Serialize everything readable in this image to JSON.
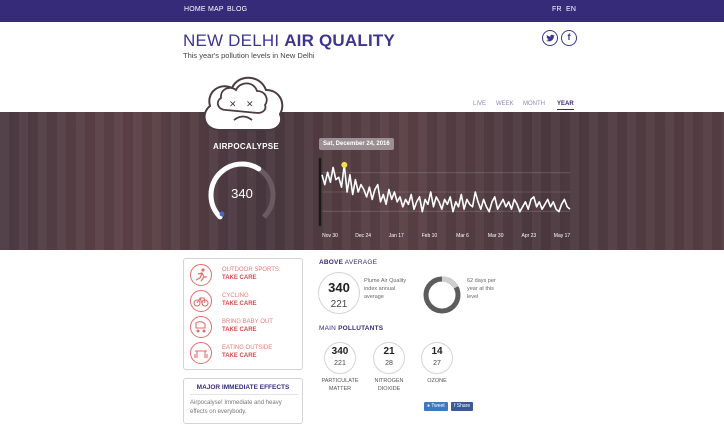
{
  "nav": {
    "home": "HOME",
    "map": "MAP",
    "blog": "BLOG",
    "lang_fr": "FR",
    "lang_en": "EN"
  },
  "header": {
    "title_light": "NEW DELHI",
    "title_bold": "AIR QUALITY",
    "subtitle": "This year's pollution levels in New Delhi",
    "twitter_icon": "twitter-icon",
    "facebook_icon": "facebook-icon"
  },
  "tabs": [
    "LIVE",
    "WEEK",
    "MONTH",
    "YEAR"
  ],
  "active_tab": "YEAR",
  "hero": {
    "status_label": "AIRPOCALYPSE",
    "aqi_value": "340",
    "aqi_fraction": 0.62,
    "selected_date": "Sat, December 24, 2016",
    "cloud_icon": "sad-cloud-icon",
    "accent": "#352b78"
  },
  "chart_data": {
    "type": "line",
    "x_labels": [
      "Nov 30",
      "Dec 24",
      "Jan 17",
      "Feb 10",
      "Mar 6",
      "Mar 30",
      "Apr 23",
      "May 17"
    ],
    "values": [
      300,
      260,
      310,
      270,
      330,
      280,
      290,
      250,
      340,
      230,
      300,
      220,
      280,
      230,
      260,
      240,
      210,
      250,
      200,
      240,
      260,
      190,
      220,
      180,
      240,
      200,
      230,
      190,
      210,
      170,
      200,
      180,
      220,
      160,
      190,
      210,
      150,
      200,
      180,
      230,
      170,
      210,
      190,
      160,
      200,
      180,
      210,
      150,
      190,
      170,
      220,
      160,
      200,
      180,
      170,
      230,
      190,
      160,
      200,
      170,
      150,
      190,
      210,
      160,
      180,
      200,
      170,
      190,
      160,
      200,
      180,
      150,
      170,
      190,
      160,
      200,
      210,
      170,
      190,
      160,
      180,
      200,
      170,
      190,
      160,
      150,
      180,
      200,
      170,
      160
    ],
    "highlight_index": 8,
    "ylim": [
      100,
      360
    ]
  },
  "activities": [
    {
      "title": "OUTDOOR SPORTS:",
      "status": "TAKE CARE",
      "icon": "running-icon"
    },
    {
      "title": "CYCLING",
      "status": "TAKE CARE",
      "icon": "bicycle-icon"
    },
    {
      "title": "BRING BABY OUT",
      "status": "TAKE CARE",
      "icon": "baby-stroller-icon"
    },
    {
      "title": "EATING OUTSIDE",
      "status": "TAKE CARE",
      "icon": "dining-table-icon"
    }
  ],
  "effects": {
    "title": "MAJOR IMMEDIATE EFFECTS",
    "text": "Airpocalyse! Immediate and heavy effects on everybody."
  },
  "average": {
    "label_bold": "ABOVE",
    "label_light": "AVERAGE",
    "current": "340",
    "annual": "221",
    "description": "Plume Air Quality index annual average",
    "days_text": "62 days per year at this level",
    "days_fraction": 0.17
  },
  "pollutants": {
    "label_light": "MAIN",
    "label_bold": "POLLUTANTS",
    "items": [
      {
        "current": "340",
        "average": "221",
        "name_line1": "PARTICULATE",
        "name_line2": "MATTER"
      },
      {
        "current": "21",
        "average": "28",
        "name_line1": "NITROGEN",
        "name_line2": "DIOXIDE"
      },
      {
        "current": "14",
        "average": "27",
        "name_line1": "OZONE",
        "name_line2": ""
      }
    ]
  },
  "share": {
    "tweet": "Tweet",
    "facebook": "Share"
  }
}
